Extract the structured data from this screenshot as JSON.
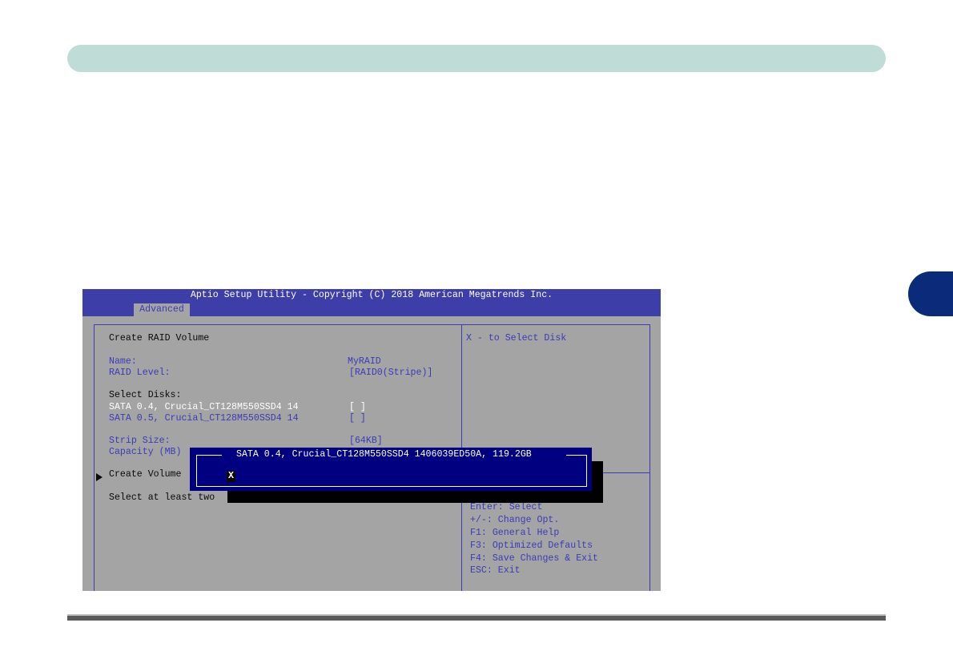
{
  "bios": {
    "title": "Aptio Setup Utility - Copyright (C) 2018 American Megatrends Inc.",
    "active_tab": "Advanced",
    "screen_title": "Create RAID Volume",
    "name_label": "Name:",
    "name_value": "MyRAID",
    "raid_level_label": "RAID Level:",
    "raid_level_value": "[RAID0(Stripe)]",
    "select_disks_label": "Select Disks:",
    "disks": [
      {
        "label": "SATA 0.4, Crucial_CT128M550SSD4 14",
        "value": "[ ]"
      },
      {
        "label": "SATA 0.5, Crucial_CT128M550SSD4 14",
        "value": "[ ]"
      }
    ],
    "strip_size_label": "Strip Size:",
    "strip_size_value": "[64KB]",
    "capacity_label": "Capacity (MB)",
    "create_volume_label": "Create Volume",
    "status_text": "Select at least two",
    "help_text": "X - to Select Disk",
    "key_help": [
      "Enter: Select",
      "+/-: Change Opt.",
      "F1: General Help",
      "F3: Optimized Defaults",
      "F4: Save Changes & Exit",
      "ESC: Exit"
    ],
    "popup": {
      "title": "SATA 0.4, Crucial_CT128M550SSD4 1406039ED50A, 119.2GB",
      "option": "X"
    },
    "colors": {
      "title_bar": "#3e3ea8",
      "background": "#a4a4a4",
      "highlight_text": "#3b3bb8",
      "popup": "#000080"
    }
  },
  "page": {
    "colors": {
      "header_bar": "#bfdcd6",
      "chapter_tab": "#0b2a7a"
    }
  }
}
